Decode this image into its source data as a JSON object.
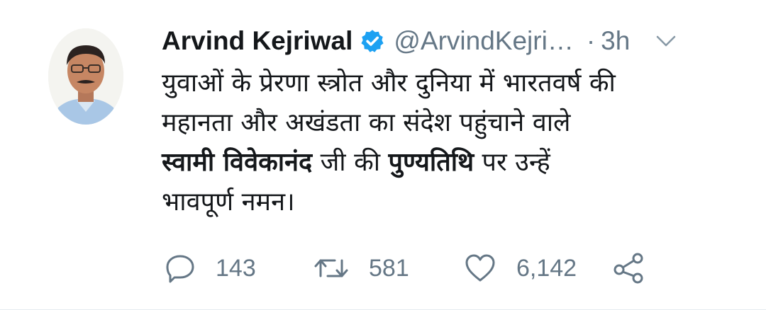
{
  "author": {
    "name": "Arvind Kejriwal",
    "handle": "@ArvindKejri…",
    "separator": "·",
    "time": "3h",
    "verified": true,
    "avatar_icon": "profile-photo"
  },
  "tweet": {
    "line1": "युवाओं के प्रेरणा स्त्रोत और दुनिया में भारतवर्ष की",
    "line2": "महानता और अखंडता का संदेश पहुंचाने वाले",
    "line3_bold1": "स्वामी विवेकानंद",
    "line3_plain1": " जी की ",
    "line3_bold2": "पुण्यतिथि",
    "line3_plain2": " पर उन्हें",
    "line4": "भावपूर्ण नमन।"
  },
  "actions": {
    "reply_count": "143",
    "retweet_count": "581",
    "like_count": "6,142"
  },
  "colors": {
    "text": "#14171a",
    "secondary": "#657786",
    "verified": "#1da1f2"
  }
}
